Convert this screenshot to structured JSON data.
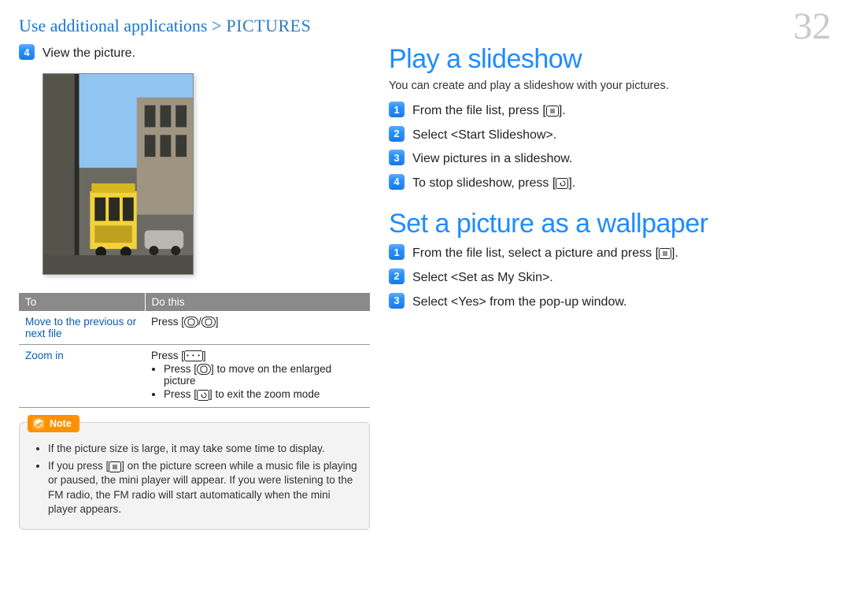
{
  "header": {
    "crumb1": "Use additional applications >",
    "crumb2": " PICTURES"
  },
  "page_number": "32",
  "left": {
    "step4": {
      "num": "4",
      "text": "View the picture."
    },
    "table": {
      "head": [
        "To",
        "Do this"
      ],
      "rows": [
        {
          "to": "Move to the previous or next file",
          "do_prefix": "Press [",
          "do_mid": "/",
          "do_suffix": "]"
        },
        {
          "to": "Zoom in",
          "line1_prefix": "Press [",
          "line1_suffix": "]",
          "b1_prefix": "Press [",
          "b1_suffix": "] to move on the enlarged picture",
          "b2_prefix": "Press [",
          "b2_suffix": "] to exit the zoom mode"
        }
      ]
    },
    "note": {
      "label": "Note",
      "items": [
        "If the picture size is large, it may take some time to display.",
        {
          "pre": "If you press [",
          "post": "] on the picture screen while a music file is playing or paused, the mini player will appear. If you were listening to the FM radio, the FM radio will start automatically when the mini player appears."
        }
      ]
    }
  },
  "right": {
    "section1": {
      "title": "Play a slideshow",
      "lead": "You can create and play a slideshow with your pictures.",
      "steps": [
        {
          "num": "1",
          "pre": "From the file list, press [",
          "post": "]."
        },
        {
          "num": "2",
          "text": "Select <Start Slideshow>."
        },
        {
          "num": "3",
          "text": "View pictures in a slideshow."
        },
        {
          "num": "4",
          "pre": "To stop slideshow, press [",
          "post": "]."
        }
      ]
    },
    "section2": {
      "title": "Set a picture as a wallpaper",
      "steps": [
        {
          "num": "1",
          "pre": "From the file list, select a picture and press [",
          "post": "]."
        },
        {
          "num": "2",
          "text": "Select <Set as My Skin>."
        },
        {
          "num": "3",
          "text": "Select <Yes> from the pop-up window."
        }
      ]
    }
  }
}
